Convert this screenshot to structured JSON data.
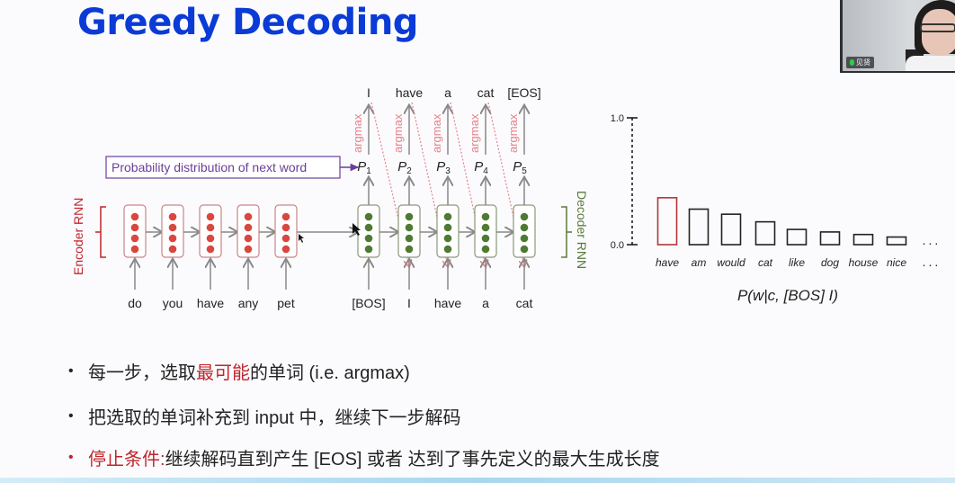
{
  "slide": {
    "title": "Greedy Decoding"
  },
  "webcam": {
    "participant_name": "见贤",
    "mic_icon": "mic-icon"
  },
  "diagram": {
    "prob_label": "Probability distribution of next word",
    "encoder_label": "Encoder RNN",
    "decoder_label": "Decoder RNN",
    "encoder_inputs": [
      "do",
      "you",
      "have",
      "any",
      "pet"
    ],
    "decoder_inputs": [
      "[BOS]",
      "I",
      "have",
      "a",
      "cat"
    ],
    "decoder_outputs": [
      "I",
      "have",
      "a",
      "cat",
      "[EOS]"
    ],
    "prob_symbols": [
      "P1",
      "P2",
      "P3",
      "P4",
      "P5"
    ],
    "argmax_label": "argmax",
    "colors": {
      "encoder": "#c0262d",
      "decoder": "#5a7a3a",
      "purple": "#6a3e9a",
      "argmax": "#e8828a"
    }
  },
  "chart_data": {
    "type": "bar",
    "title": "",
    "xlabel": "P(w|c, [BOS] I)",
    "ylabel": "",
    "ylim": [
      0.0,
      1.0
    ],
    "yticks": [
      "0.0",
      "1.0"
    ],
    "categories": [
      "have",
      "am",
      "would",
      "cat",
      "like",
      "dog",
      "house",
      "nice"
    ],
    "values": [
      0.37,
      0.28,
      0.24,
      0.18,
      0.12,
      0.1,
      0.08,
      0.06
    ],
    "highlight": "have",
    "highlight_color": "#b5353b",
    "trailing": "..."
  },
  "bullets": [
    {
      "pre": "每一步，选取",
      "highlight": "最可能",
      "post": "的单词 (i.e. argmax)"
    },
    {
      "pre": "把选取的单词补充到 input 中，继续下一步解码",
      "highlight": "",
      "post": ""
    },
    {
      "pre": "",
      "highlight": "停止条件:",
      "post": " 继续解码直到产生 [EOS] 或者 达到了事先定义的最大生成长度"
    }
  ]
}
